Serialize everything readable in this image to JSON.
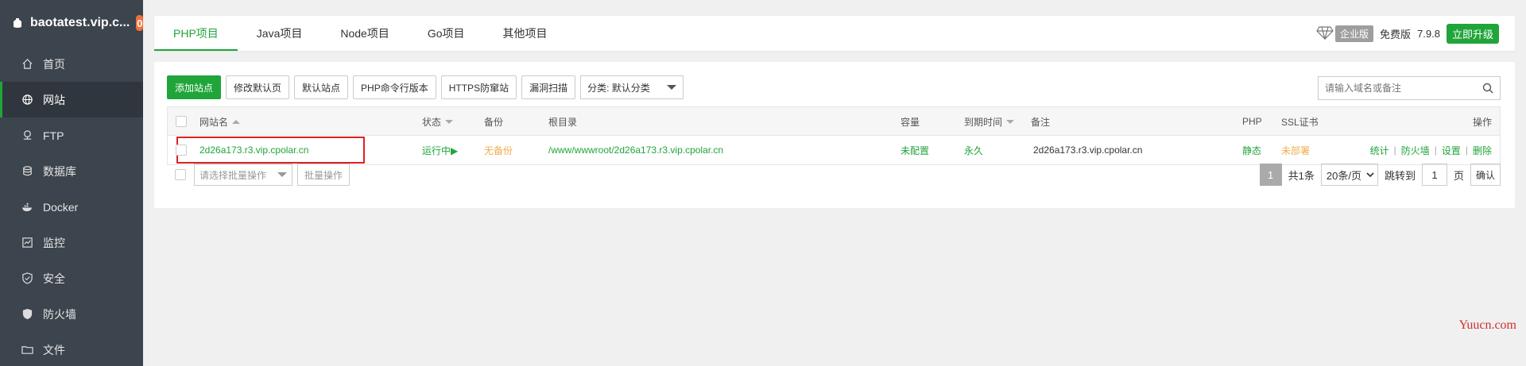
{
  "sidebar": {
    "host": "baotatest.vip.c...",
    "badge": "0",
    "items": [
      {
        "label": "首页",
        "icon": "home-icon"
      },
      {
        "label": "网站",
        "icon": "globe-icon"
      },
      {
        "label": "FTP",
        "icon": "ftp-icon"
      },
      {
        "label": "数据库",
        "icon": "database-icon"
      },
      {
        "label": "Docker",
        "icon": "docker-icon"
      },
      {
        "label": "监控",
        "icon": "monitor-icon"
      },
      {
        "label": "安全",
        "icon": "shield-icon"
      },
      {
        "label": "防火墙",
        "icon": "firewall-icon"
      },
      {
        "label": "文件",
        "icon": "folder-icon"
      }
    ]
  },
  "tabs": [
    "PHP项目",
    "Java项目",
    "Node项目",
    "Go项目",
    "其他项目"
  ],
  "topright": {
    "edition": "企业版",
    "free": "免费版",
    "version": "7.9.8",
    "upgrade": "立即升级"
  },
  "toolbar": {
    "add_site": "添加站点",
    "modify_default": "修改默认页",
    "default_site": "默认站点",
    "php_cli": "PHP命令行版本",
    "https_guard": "HTTPS防窜站",
    "vuln_scan": "漏洞扫描",
    "category": "分类: 默认分类"
  },
  "search": {
    "placeholder": "请输入域名或备注"
  },
  "table": {
    "headers": {
      "name": "网站名",
      "status": "状态",
      "backup": "备份",
      "root": "根目录",
      "capacity": "容量",
      "expire": "到期时间",
      "remark": "备注",
      "php": "PHP",
      "ssl": "SSL证书",
      "ops": "操作"
    },
    "row": {
      "name": "2d26a173.r3.vip.cpolar.cn",
      "status": "运行中▶",
      "backup": "无备份",
      "root": "/www/wwwroot/2d26a173.r3.vip.cpolar.cn",
      "capacity": "未配置",
      "expire": "永久",
      "remark": "2d26a173.r3.vip.cpolar.cn",
      "php": "静态",
      "ssl": "未部署",
      "ops": [
        "统计",
        "防火墙",
        "设置",
        "删除"
      ]
    }
  },
  "footer": {
    "batch_select": "请选择批量操作",
    "batch_btn": "批量操作",
    "page": "1",
    "total": "共1条",
    "per_page": "20条/页",
    "jump": "跳转到",
    "jump_value": "1",
    "page_unit": "页",
    "confirm": "确认"
  },
  "watermark": "Yuucn.com",
  "colors": {
    "accent": "#20a53a",
    "sidebar": "#3c444d",
    "warn": "#f0ad4e",
    "highlight": "#e02020"
  }
}
